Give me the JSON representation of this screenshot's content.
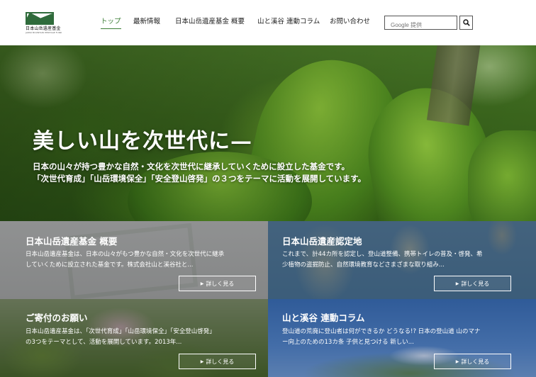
{
  "header": {
    "logo": {
      "text": "日本山岳遺産基金",
      "subtext": "JAPAN MOUNTAIN HERITAGE FUND"
    },
    "nav": [
      {
        "label": "トップ",
        "active": true
      },
      {
        "label": "最新情報",
        "active": false
      },
      {
        "label": "日本山岳遺産基金 概要",
        "active": false
      },
      {
        "label": "山と溪谷 連動コラム",
        "active": false
      },
      {
        "label": "お問い合わせ",
        "active": false
      }
    ],
    "search": {
      "placeholder": "Google 提供",
      "button_icon": "search-icon"
    }
  },
  "hero": {
    "title": "美しい山を次世代に—",
    "lines": [
      "日本の山々が持つ豊かな自然・文化を次世代に継承していくために設立した基金です。",
      "「次世代育成」「山岳環境保全」「安全登山啓発」の３つをテーマに活動を展開しています。"
    ]
  },
  "cards": [
    {
      "title": "日本山岳遺産基金 概要",
      "lines": [
        "日本山岳遺産基金は、日本の山々がもつ豊かな自然・文化を次世代に継承",
        "していくために設立された基金です。株式会社山と溪谷社と..."
      ],
      "button": "詳しく見る"
    },
    {
      "title": "日本山岳遺産認定地",
      "lines": [
        "これまで、計44カ所を認定し、登山道整備、携帯トイレの普及・啓発、希",
        "少植物の盗掘防止、自然環境教育などさまざまな取り組み..."
      ],
      "button": "詳しく見る"
    },
    {
      "title": "ご寄付のお願い",
      "lines": [
        "日本山岳遺産基金は、「次世代育成」「山岳環境保全」「安全登山啓発」",
        "の3つをテーマとして、活動を展開しています。2013年..."
      ],
      "button": "詳しく見る"
    },
    {
      "title": "山と溪谷 連動コラム",
      "lines": [
        "登山道の荒廃に登山者は何ができるか どうなる!? 日本の登山道 山のマナ",
        "ー向上のための13カ条 子供と見つける 新しい..."
      ],
      "button": "詳しく見る"
    }
  ],
  "colors": {
    "accent": "#3a7d34",
    "text": "#222222"
  }
}
